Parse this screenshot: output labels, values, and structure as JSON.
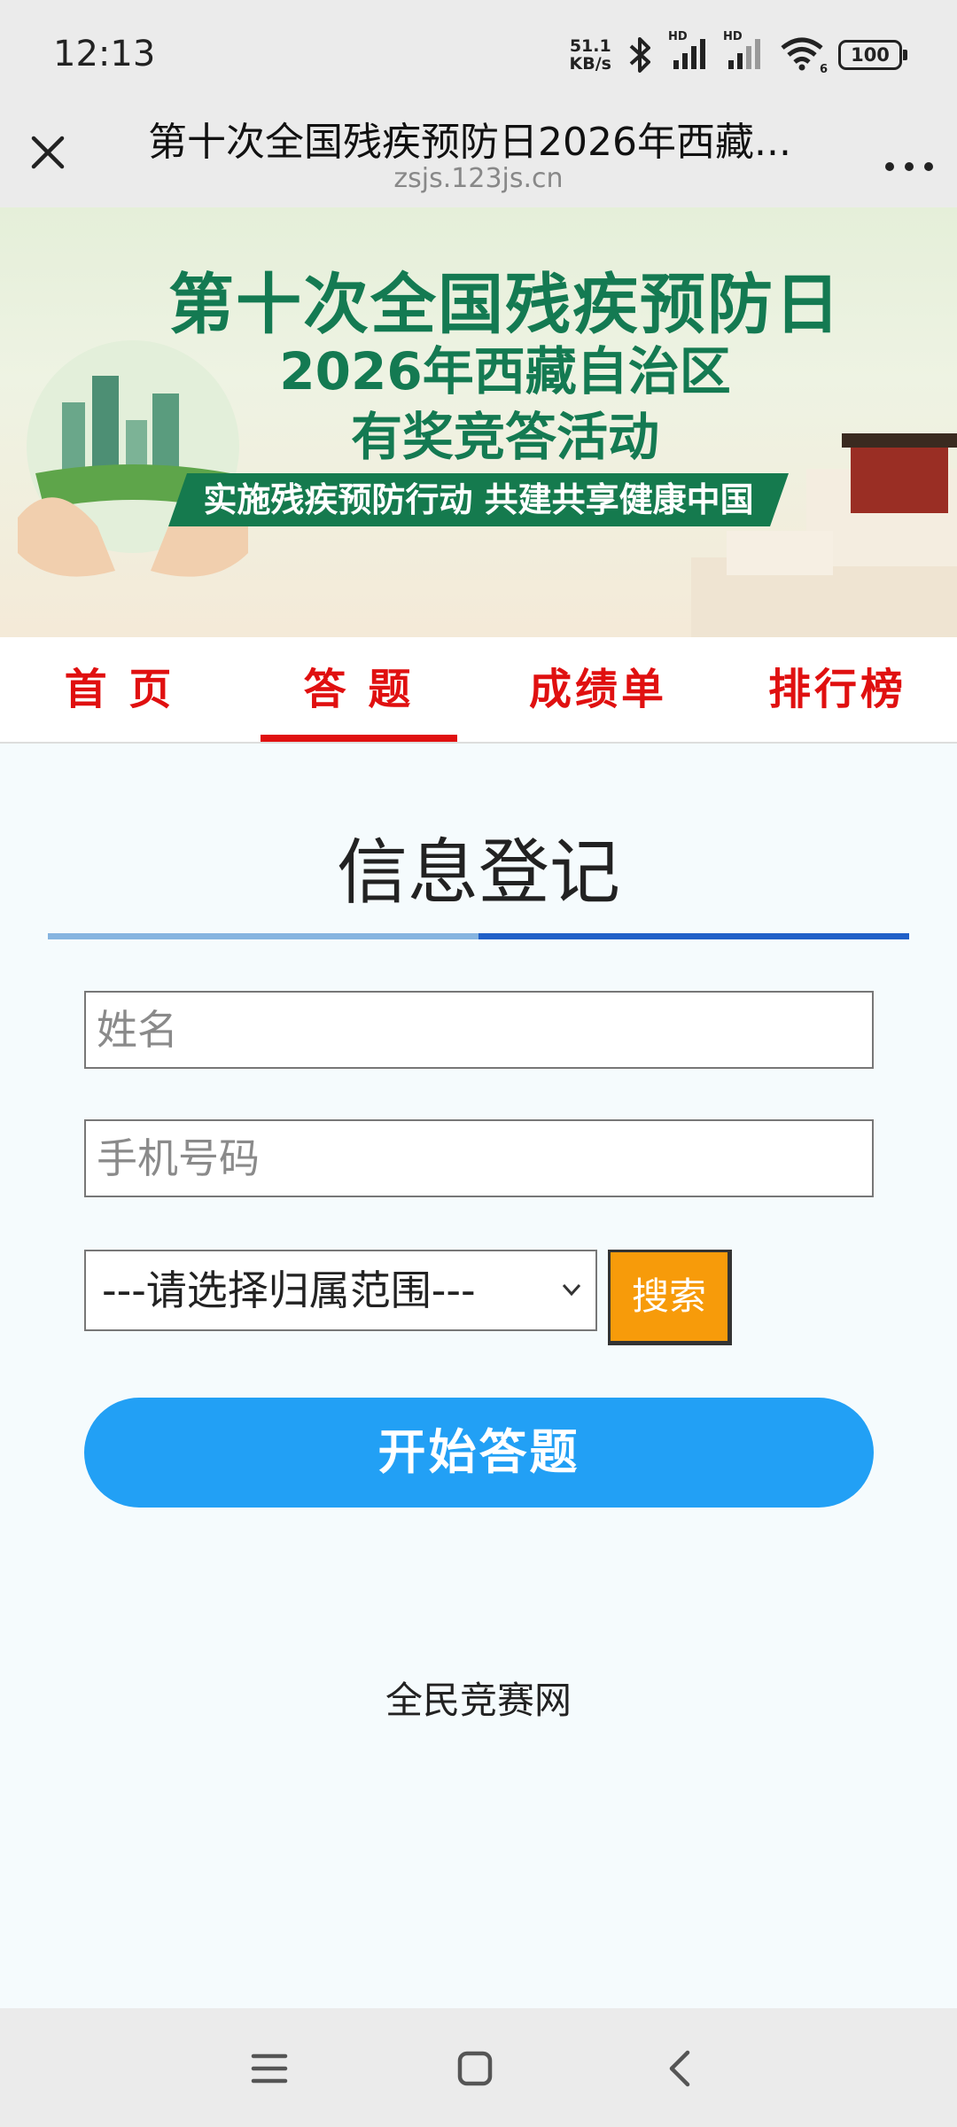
{
  "status_bar": {
    "time": "12:13",
    "net_speed_value": "51.1",
    "net_speed_unit": "KB/s",
    "hd_label_1": "HD",
    "hd_label_2": "HD",
    "wifi_label": "6",
    "battery": "100",
    "icons": [
      "bluetooth-icon",
      "signal-icon",
      "signal-icon",
      "wifi-icon",
      "battery-icon"
    ]
  },
  "browser": {
    "title": "第十次全国残疾预防日2026年西藏...",
    "url": "zsjs.123js.cn",
    "close_icon": "close-icon",
    "more_icon": "more-icon"
  },
  "banner": {
    "line1": "第十次全国残疾预防日",
    "line2": "2026年西藏自治区",
    "line3": "有奖竞答活动",
    "ribbon": "实施残疾预防行动  共建共享健康中国"
  },
  "tabs": [
    {
      "label": "首 页",
      "active": false
    },
    {
      "label": "答 题",
      "active": true
    },
    {
      "label": "成绩单",
      "active": false
    },
    {
      "label": "排行榜",
      "active": false
    }
  ],
  "form": {
    "title": "信息登记",
    "name_placeholder": "姓名",
    "phone_placeholder": "手机号码",
    "scope_select": "---请选择归属范围---",
    "search_button": "搜索",
    "start_button": "开始答题"
  },
  "footer": {
    "text": "全民竞赛网"
  },
  "colors": {
    "tab_red": "#e01010",
    "start_button_blue": "#22a0f5",
    "search_button_orange": "#f79b0a",
    "banner_green": "#147a52"
  },
  "nav_bar": {
    "icons": [
      "menu-icon",
      "home-icon",
      "back-icon"
    ]
  }
}
